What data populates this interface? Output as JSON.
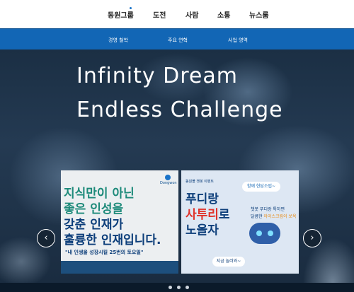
{
  "topnav": {
    "items": [
      {
        "label": "동원그룹"
      },
      {
        "label": "도전"
      },
      {
        "label": "사람"
      },
      {
        "label": "소통"
      },
      {
        "label": "뉴스룸"
      }
    ]
  },
  "subnav": {
    "items": [
      {
        "label": "경영 철학"
      },
      {
        "label": "주요 연혁"
      },
      {
        "label": "사업 영역"
      }
    ]
  },
  "hero": {
    "line1": "Infinity Dream",
    "line2": "Endless Challenge",
    "prev_label": "‹",
    "next_label": "›"
  },
  "cards": [
    {
      "lines": [
        "지식만이 아닌",
        "좋은 인성을",
        "갖춘 인재가",
        "훌륭한 인재입니다."
      ],
      "logo": "Dongwon",
      "caption": "\"내 인생을 성장시킬 25번의 토요일\""
    },
    {
      "tag": "동원몰 챗봇 이벤트",
      "pill": "함께 헌답소립~",
      "big1": "푸디랑",
      "big2a": "사투리",
      "big2b": "로",
      "big3": "노올자",
      "small1": "챗봇 푸디랑 톡하면",
      "small2a": "달콤한 ",
      "small2b": "아이스크림이 쏘옥",
      "button": "지금 놀러와~"
    }
  ],
  "colors": {
    "accent_blue": "#1266b5",
    "teal": "#1d8a7a",
    "orange": "#e98a10",
    "red": "#e0332b"
  }
}
